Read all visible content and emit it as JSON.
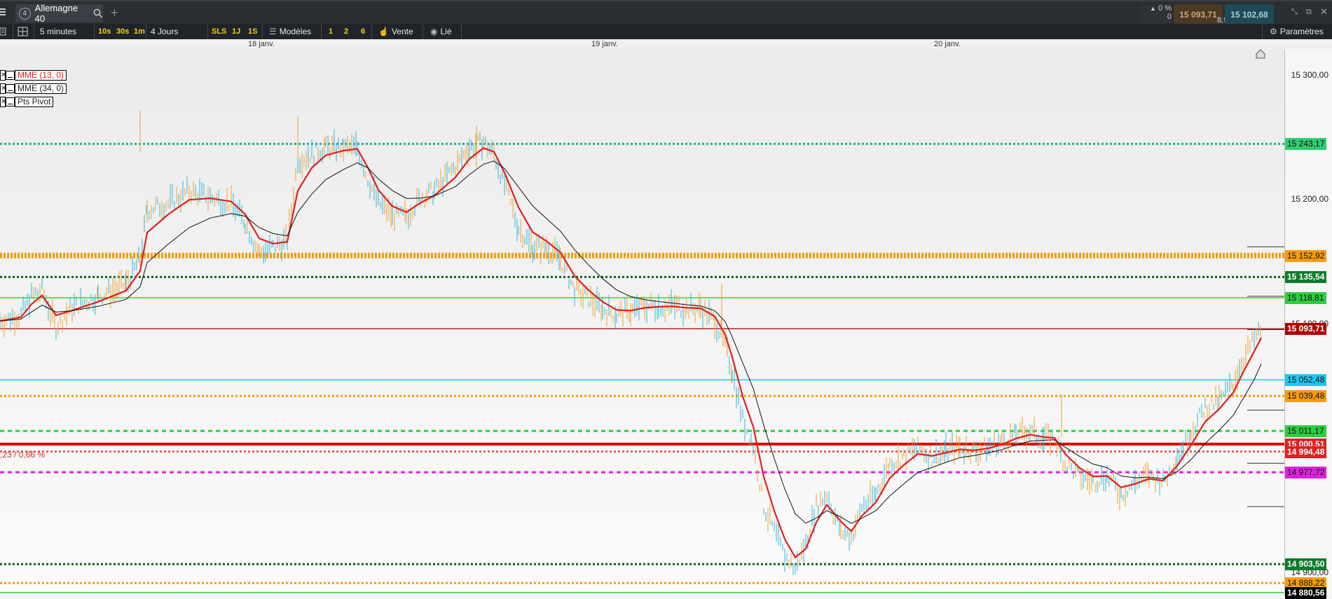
{
  "window": {
    "instrument": "Allemagne 40",
    "tab_number": "4",
    "change_pct": "0 %",
    "change_count": "0",
    "bid": "15 093,71",
    "ask": "15 102,68",
    "spread": "8,97"
  },
  "toolbar": {
    "timeframe": "5 minutes",
    "quick_frames": [
      "10s",
      "30s",
      "1m"
    ],
    "period": "4 Jours",
    "range_buttons": [
      "SLS",
      "1J",
      "1S"
    ],
    "models_label": "Modèles",
    "layout_buttons": [
      "1",
      "2",
      "6"
    ],
    "sell_label": "Vente",
    "linked_label": "Lié",
    "settings_label": "Paramètres"
  },
  "date_axis": [
    "18 janv.",
    "19 janv.",
    "20 janv."
  ],
  "legend": [
    {
      "label": "MME (13, 0)",
      "color": "#e02020"
    },
    {
      "label": "MME (34, 0)",
      "color": "#000000"
    },
    {
      "label": "Pts Pivot",
      "color": "#000000"
    }
  ],
  "annotation": ",23 / 0,66 %",
  "price_axis": [
    "15 300,00",
    "15 200,00",
    "15 100,00",
    "14 900,00"
  ],
  "levels": [
    {
      "label": "15 243,17",
      "value": 15243.17,
      "bg": "#2ecc71",
      "fg": "#111",
      "line": "#18b090",
      "style": "dotted"
    },
    {
      "label": "15 152,92",
      "value": 15152.92,
      "bg": "#f39c12",
      "fg": "#111",
      "line": "#f39c12",
      "style": "thick-dash"
    },
    {
      "label": "15 135,54",
      "value": 15135.54,
      "bg": "#117a2c",
      "fg": "#fff",
      "line": "#0c5e20",
      "style": "dotted"
    },
    {
      "label": "15 118,81",
      "value": 15118.81,
      "bg": "#2ecc40",
      "fg": "#111",
      "line": "#3bd13b",
      "style": "solid"
    },
    {
      "label": "15 093,71",
      "value": 15093.71,
      "bg": "#b00000",
      "fg": "#fff",
      "line": "#b22222",
      "style": "solid"
    },
    {
      "label": "15 052,48",
      "value": 15052.48,
      "bg": "#1ec8f0",
      "fg": "#111",
      "line": "#1ec8f0",
      "style": "solid"
    },
    {
      "label": "15 039,48",
      "value": 15039.48,
      "bg": "#f39c12",
      "fg": "#111",
      "line": "#f39c12",
      "style": "dotted"
    },
    {
      "label": "15 011,17",
      "value": 15011.17,
      "bg": "#2ecc40",
      "fg": "#111",
      "line": "#2ecc40",
      "style": "dashed"
    },
    {
      "label": "15 000,51",
      "value": 15000.51,
      "bg": "#e02020",
      "fg": "#fff",
      "line": "#e00000",
      "style": "thick"
    },
    {
      "label": "14 994,48",
      "value": 14994.48,
      "bg": "#e02020",
      "fg": "#fff",
      "line": "#e06060",
      "style": "dotted"
    },
    {
      "label": "14 977,72",
      "value": 14977.72,
      "bg": "#e020e0",
      "fg": "#111",
      "line": "#e020e0",
      "style": "dashed"
    },
    {
      "label": "14 903,50",
      "value": 14903.5,
      "bg": "#117a2c",
      "fg": "#fff",
      "line": "#0c5e20",
      "style": "dotted"
    },
    {
      "label": "14 888,22",
      "value": 14888.22,
      "bg": "#f39c12",
      "fg": "#111",
      "line": "#f39c12",
      "style": "dotted"
    },
    {
      "label": "14 880,56",
      "value": 14880.56,
      "bg": "#000000",
      "fg": "#fff",
      "line": "#2ecc40",
      "style": "solid"
    }
  ]
}
